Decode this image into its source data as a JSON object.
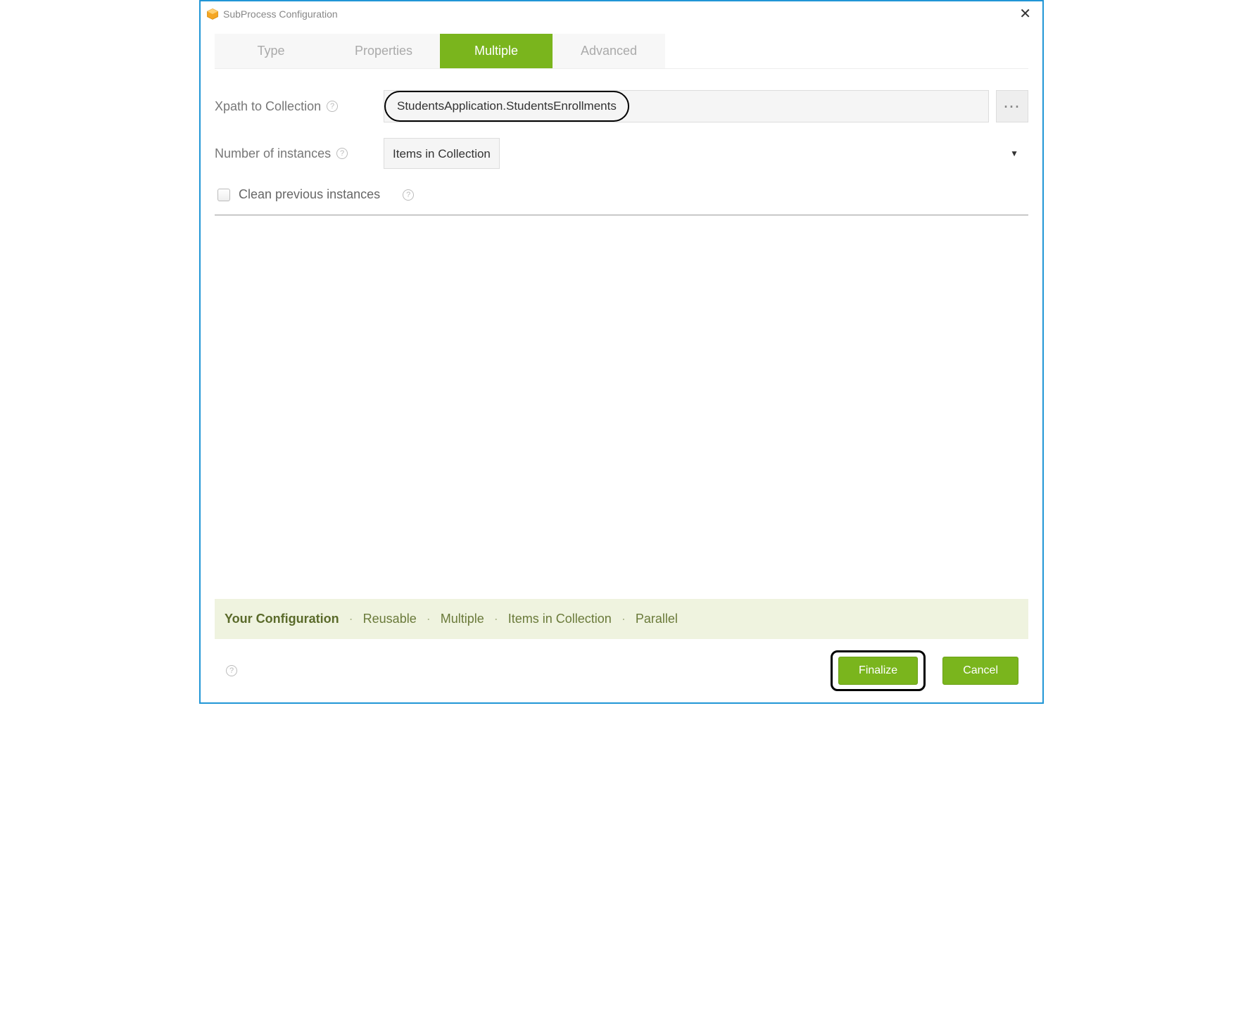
{
  "window": {
    "title": "SubProcess Configuration"
  },
  "tabs": [
    {
      "label": "Type",
      "active": false
    },
    {
      "label": "Properties",
      "active": false
    },
    {
      "label": "Multiple",
      "active": true
    },
    {
      "label": "Advanced",
      "active": false
    }
  ],
  "form": {
    "xpath": {
      "label": "Xpath to Collection",
      "value": "StudentsApplication.StudentsEnrollments"
    },
    "instances": {
      "label": "Number of instances",
      "value": "Items in Collection"
    },
    "cleanPrev": {
      "label": "Clean previous instances",
      "checked": false
    }
  },
  "summary": {
    "title": "Your Configuration",
    "items": [
      "Reusable",
      "Multiple",
      "Items in Collection",
      "Parallel"
    ]
  },
  "footer": {
    "finalize": "Finalize",
    "cancel": "Cancel"
  },
  "glyphs": {
    "help": "?",
    "more": "⋯",
    "close": "✕",
    "dot": "·"
  }
}
